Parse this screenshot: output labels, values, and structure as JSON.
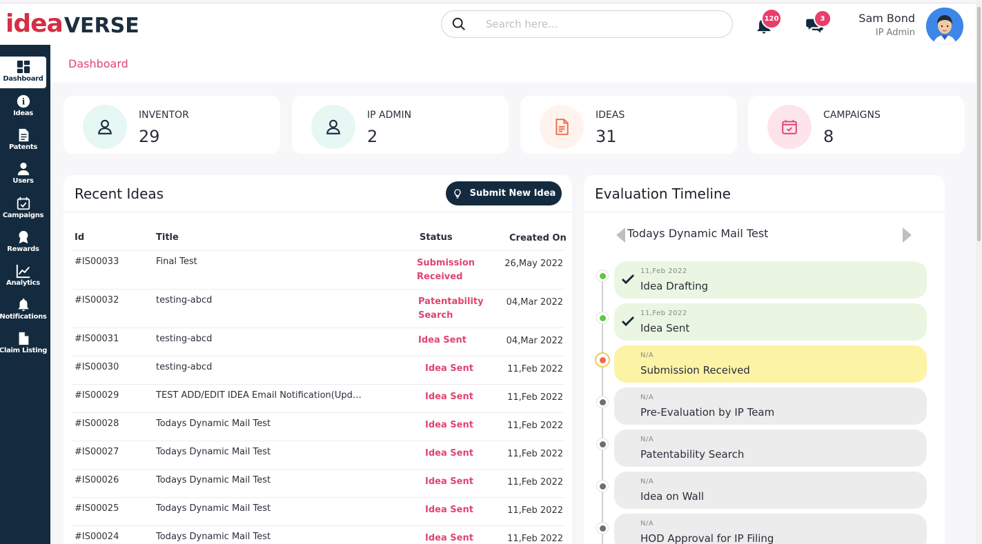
{
  "app": {
    "logo_idea": "idea",
    "logo_verse": "VERSE"
  },
  "header": {
    "search_placeholder": "Search here...",
    "notifications_count": "120",
    "messages_count": "3",
    "user_name": "Sam Bond",
    "user_role": "IP Admin"
  },
  "sidebar": {
    "items": [
      {
        "label": "Dashboard",
        "icon": "dashboard-icon",
        "active": true
      },
      {
        "label": "Ideas",
        "icon": "info-icon"
      },
      {
        "label": "Patents",
        "icon": "document-icon"
      },
      {
        "label": "Users",
        "icon": "user-icon"
      },
      {
        "label": "Campaigns",
        "icon": "calendar-check-icon"
      },
      {
        "label": "Rewards",
        "icon": "award-icon"
      },
      {
        "label": "Analytics",
        "icon": "chart-line-icon"
      },
      {
        "label": "Notifications",
        "icon": "bell-icon"
      },
      {
        "label": "Claim Listing",
        "icon": "file-icon"
      }
    ]
  },
  "breadcrumb": "Dashboard",
  "stats": [
    {
      "label": "INVENTOR",
      "value": "29",
      "icon": "user-icon",
      "color": "#e6f7f4"
    },
    {
      "label": "IP ADMIN",
      "value": "2",
      "icon": "user-icon",
      "color": "#e6f7f4"
    },
    {
      "label": "IDEAS",
      "value": "31",
      "icon": "document-icon",
      "color": "#fff3ee"
    },
    {
      "label": "CAMPAIGNS",
      "value": "8",
      "icon": "calendar-check-icon",
      "color": "#fde4ea"
    }
  ],
  "recent_ideas": {
    "title": "Recent Ideas",
    "submit_label": "Submit New Idea",
    "columns": [
      "Id",
      "Title",
      "Status",
      "Created On"
    ],
    "rows": [
      {
        "id": "#IS00033",
        "title": "Final Test",
        "status": "Submission Received",
        "date": "26,May 2022"
      },
      {
        "id": "#IS00032",
        "title": "testing-abcd",
        "status": "Patentability Search",
        "date": "04,Mar 2022"
      },
      {
        "id": "#IS00031",
        "title": "testing-abcd",
        "status": "Idea Sent",
        "date": "04,Mar 2022"
      },
      {
        "id": "#IS00030",
        "title": "testing-abcd",
        "status": "Idea Sent",
        "date": "11,Feb 2022"
      },
      {
        "id": "#IS00029",
        "title": "TEST ADD/EDIT IDEA Email Notification(Upda...",
        "status": "Idea Sent",
        "date": "11,Feb 2022"
      },
      {
        "id": "#IS00028",
        "title": "Todays Dynamic Mail Test",
        "status": "Idea Sent",
        "date": "11,Feb 2022"
      },
      {
        "id": "#IS00027",
        "title": "Todays Dynamic Mail Test",
        "status": "Idea Sent",
        "date": "11,Feb 2022"
      },
      {
        "id": "#IS00026",
        "title": "Todays Dynamic Mail Test",
        "status": "Idea Sent",
        "date": "11,Feb 2022"
      },
      {
        "id": "#IS00025",
        "title": "Todays Dynamic Mail Test",
        "status": "Idea Sent",
        "date": "11,Feb 2022"
      },
      {
        "id": "#IS00024",
        "title": "Todays Dynamic Mail Test",
        "status": "Idea Sent",
        "date": "11,Feb 2022"
      }
    ]
  },
  "timeline": {
    "title": "Evaluation Timeline",
    "subject": "Todays Dynamic Mail Test",
    "steps": [
      {
        "date": "11,Feb 2022",
        "name": "Idea Drafting",
        "state": "done"
      },
      {
        "date": "11,Feb 2022",
        "name": "Idea Sent",
        "state": "done"
      },
      {
        "date": "N/A",
        "name": "Submission Received",
        "state": "current"
      },
      {
        "date": "N/A",
        "name": "Pre-Evaluation by IP Team",
        "state": "pending"
      },
      {
        "date": "N/A",
        "name": "Patentability Search",
        "state": "pending"
      },
      {
        "date": "N/A",
        "name": "Idea on Wall",
        "state": "pending"
      },
      {
        "date": "N/A",
        "name": "HOD Approval for IP Filing",
        "state": "pending"
      }
    ]
  },
  "colors": {
    "brand_red": "#d32f45",
    "navy": "#142b3f",
    "status_pink": "#e0446f",
    "done_bg": "#eaf6e1",
    "current_bg": "#fcf3a5",
    "pending_bg": "#ececec",
    "done_dot": "#5ec940",
    "current_dot": "#f06a4a",
    "pending_dot": "#6f6f6f"
  }
}
